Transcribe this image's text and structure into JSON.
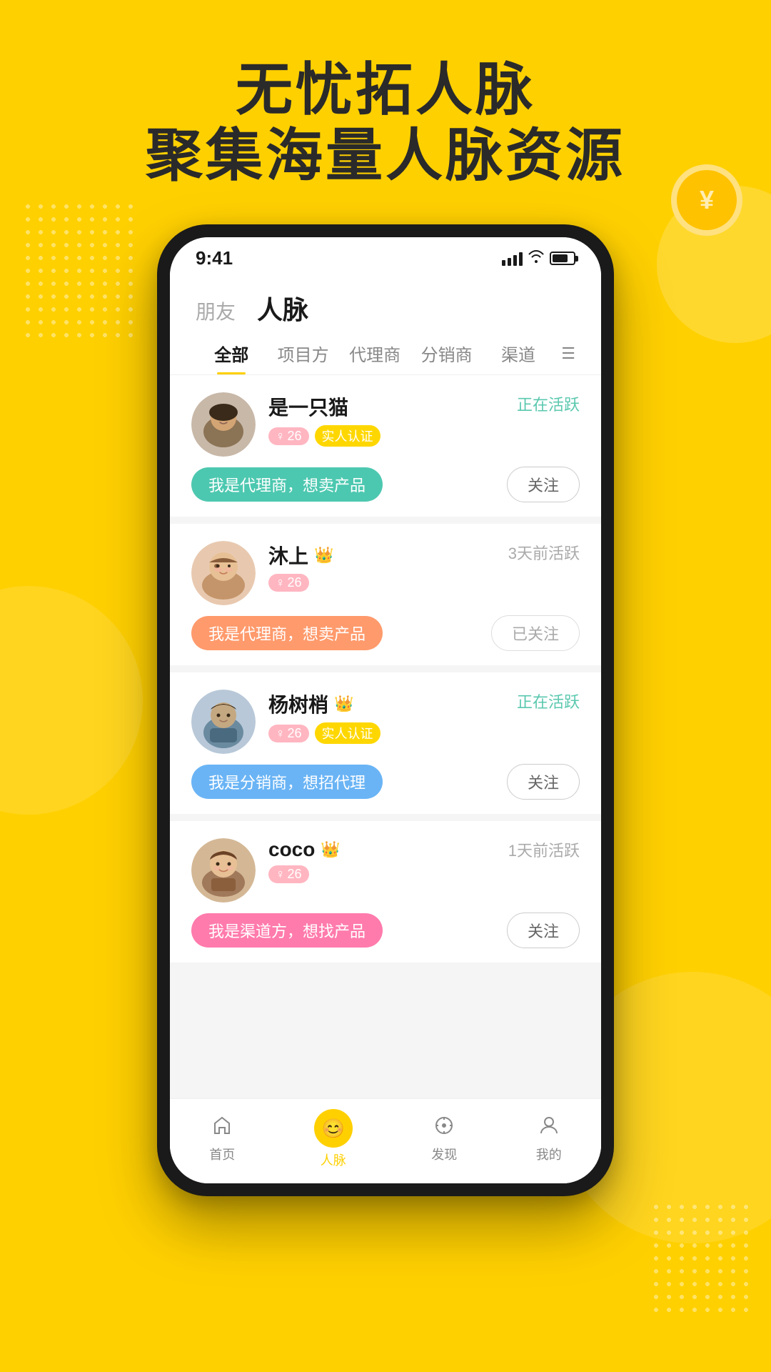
{
  "background_color": "#FFD000",
  "header": {
    "line1": "无忧拓人脉",
    "line2": "聚集海量人脉资源"
  },
  "status_bar": {
    "time": "9:41"
  },
  "nav_main_tabs": [
    {
      "label": "朋友",
      "active": false
    },
    {
      "label": "人脉",
      "active": true
    }
  ],
  "filter_tabs": [
    {
      "label": "全部",
      "active": true
    },
    {
      "label": "项目方",
      "active": false
    },
    {
      "label": "代理商",
      "active": false
    },
    {
      "label": "分销商",
      "active": false
    },
    {
      "label": "渠道",
      "active": false
    }
  ],
  "users": [
    {
      "id": 1,
      "name": "是一只猫",
      "has_crown": false,
      "gender": "♀",
      "age": "26",
      "verified": true,
      "status": "正在活跃",
      "status_active": true,
      "tag": "我是代理商，想卖产品",
      "tag_color": "tag-mint",
      "follow_label": "关注",
      "followed": false
    },
    {
      "id": 2,
      "name": "沐上",
      "has_crown": true,
      "gender": "♀",
      "age": "26",
      "verified": false,
      "status": "3天前活跃",
      "status_active": false,
      "tag": "我是代理商，想卖产品",
      "tag_color": "tag-orange",
      "follow_label": "已关注",
      "followed": true
    },
    {
      "id": 3,
      "name": "杨树梢",
      "has_crown": true,
      "gender": "♀",
      "age": "26",
      "verified": true,
      "status": "正在活跃",
      "status_active": true,
      "tag": "我是分销商，想招代理",
      "tag_color": "tag-blue",
      "follow_label": "关注",
      "followed": false
    },
    {
      "id": 4,
      "name": "coco",
      "has_crown": true,
      "gender": "♀",
      "age": "26",
      "verified": false,
      "status": "1天前活跃",
      "status_active": false,
      "tag": "我是渠道方，想找产品",
      "tag_color": "tag-pink",
      "follow_label": "关注",
      "followed": false
    }
  ],
  "bottom_nav": [
    {
      "label": "首页",
      "icon": "🔔",
      "active": false
    },
    {
      "label": "人脉",
      "icon": "😊",
      "active": true
    },
    {
      "label": "发现",
      "icon": "🎯",
      "active": false
    },
    {
      "label": "我的",
      "icon": "👤",
      "active": false
    }
  ]
}
